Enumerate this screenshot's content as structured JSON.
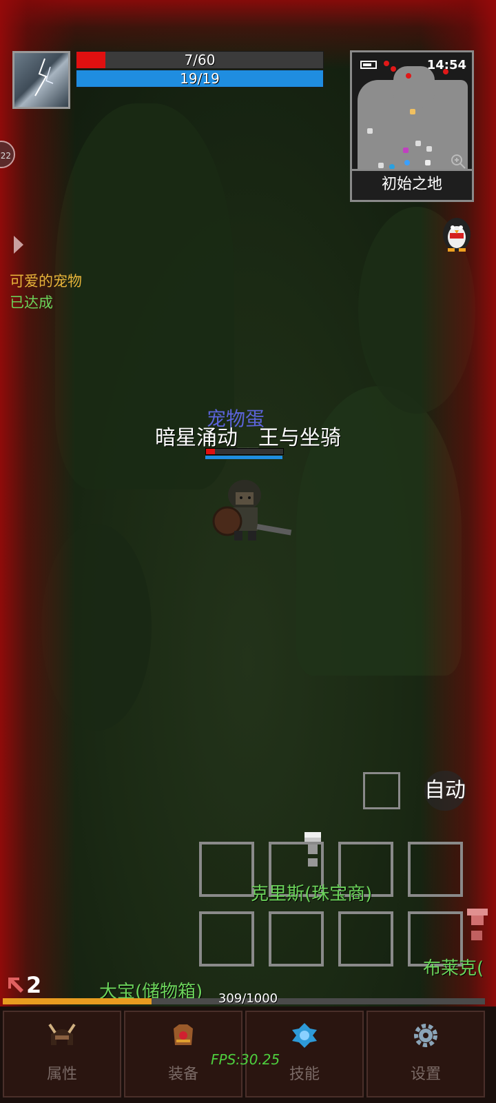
{
  "hud": {
    "hp_text": "7/60",
    "hp_fraction": 0.117,
    "mp_text": "19/19",
    "mp_fraction": 1.0,
    "side_badge": "22"
  },
  "minimap": {
    "time": "14:54",
    "location": "初始之地"
  },
  "quest": {
    "title": "可爱的宠物",
    "status": "已达成"
  },
  "world": {
    "pet_name": "宠物蛋",
    "player_name": "暗星涌动__王与坐骑",
    "player_hp_fraction": 0.12,
    "npcs": [
      {
        "name": "克里斯(珠宝商)"
      },
      {
        "name": "布莱克("
      },
      {
        "name": "大宝(储物箱)"
      }
    ]
  },
  "controls": {
    "auto_label": "自动"
  },
  "status": {
    "level": "2",
    "xp_text": "309/1000",
    "xp_fraction": 0.309,
    "fps": "FPS:30.25"
  },
  "nav": [
    {
      "label": "属性",
      "icon": "helmet-icon"
    },
    {
      "label": "装备",
      "icon": "armor-icon"
    },
    {
      "label": "技能",
      "icon": "skill-gem-icon"
    },
    {
      "label": "设置",
      "icon": "gear-icon"
    }
  ],
  "colors": {
    "hp": "#e01010",
    "mp": "#1f8de0",
    "xp": "#e89c20",
    "npc_name": "#6bd35a",
    "quest_title": "#e7b43a"
  }
}
